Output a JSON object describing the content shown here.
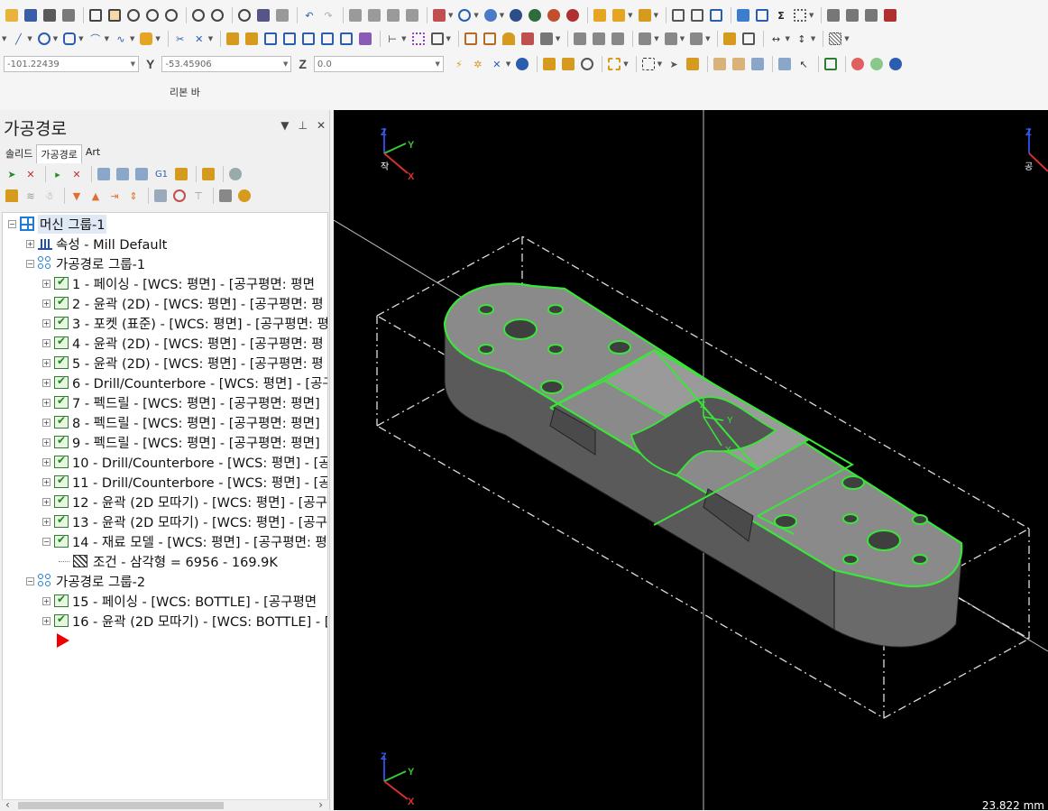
{
  "coords": {
    "x": "-101.22439",
    "y_label": "Y",
    "y": "-53.45906",
    "z_label": "Z",
    "z": "0.0"
  },
  "ribbon_caption": "리본 바",
  "panel": {
    "title": "가공경로",
    "tabs": [
      "솔리드",
      "가공경로",
      "Art"
    ],
    "active_tab": "가공경로",
    "g1_label": "G1"
  },
  "tree": {
    "root": "머신 그룹-1",
    "props": "속성 - Mill Default",
    "group1": "가공경로 그룹-1",
    "ops1": [
      "1 - 페이싱 - [WCS: 평면] - [공구평면: 평면",
      "2 - 윤곽 (2D) - [WCS: 평면] - [공구평면: 평",
      "3 - 포켓 (표준) - [WCS: 평면] - [공구평면: 평",
      "4 - 윤곽 (2D) - [WCS: 평면] - [공구평면: 평",
      "5 - 윤곽 (2D) - [WCS: 평면] - [공구평면: 평",
      "6 - Drill/Counterbore - [WCS: 평면] - [공구",
      "7 - 펙드릴 - [WCS: 평면] - [공구평면: 평면]",
      "8 - 펙드릴 - [WCS: 평면] - [공구평면: 평면]",
      "9 - 펙드릴 - [WCS: 평면] - [공구평면: 평면]",
      "10 - Drill/Counterbore - [WCS: 평면] - [공",
      "11 - Drill/Counterbore - [WCS: 평면] - [공",
      "12 - 윤곽 (2D 모따기) - [WCS: 평면] - [공구",
      "13 - 윤곽 (2D 모따기) - [WCS: 평면] - [공구",
      "14 - 재료 모델 - [WCS: 평면] - [공구평면: 평"
    ],
    "condition": "조건 - 삼각형 =  6956 - 169.9K",
    "group2": "가공경로 그룹-2",
    "ops2": [
      "15 - 페이싱 - [WCS: BOTTLE] - [공구평면",
      "16 - 윤곽 (2D 모따기) - [WCS: BOTTLE] - ["
    ]
  },
  "viewport": {
    "gnomon_tl_label": "작",
    "gnomon_tr_label": "공",
    "axis_x": "X",
    "axis_y": "Y",
    "axis_z": "Z",
    "scale": "23.822 mm",
    "colors": {
      "background": "#000000",
      "highlight": "#39e639",
      "part": "#6b6b6b"
    }
  }
}
